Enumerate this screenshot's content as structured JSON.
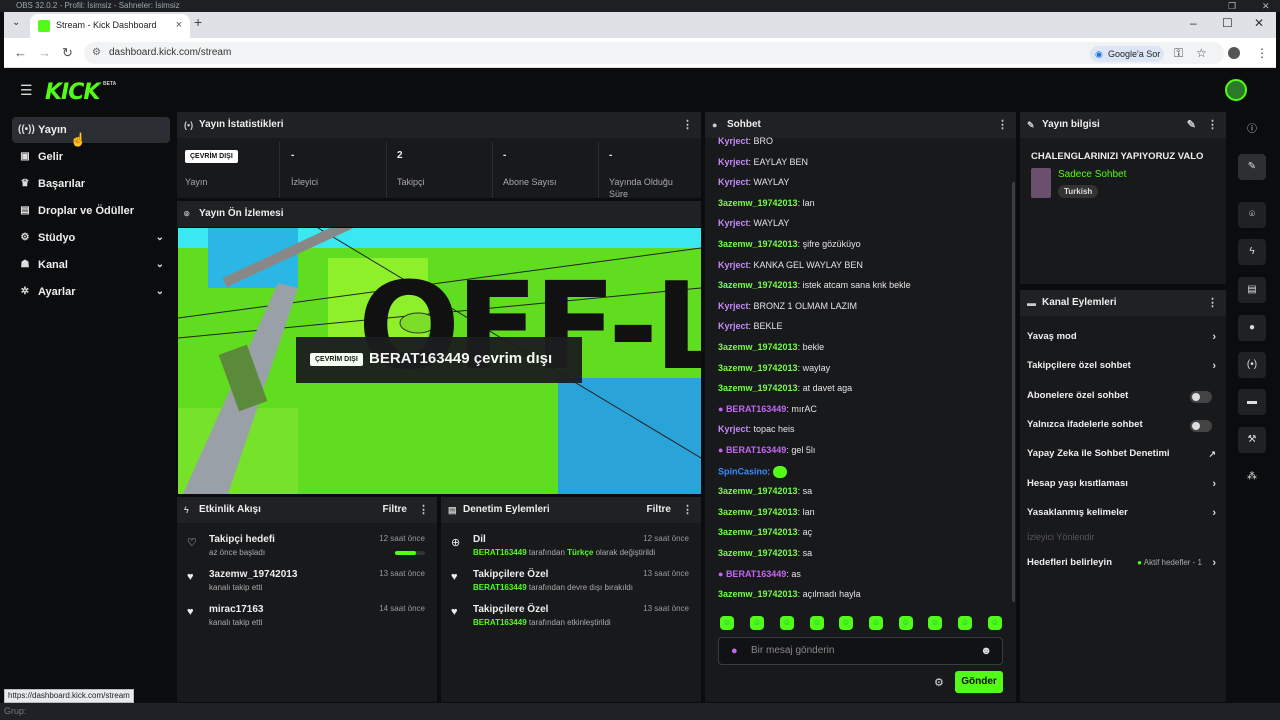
{
  "obs": {
    "title": "OBS 32.0.2 - Profil: İsimsiz - Sahneler: İsimsiz"
  },
  "browser": {
    "tab_title": "Stream - Kick Dashboard",
    "url": "dashboard.kick.com/stream",
    "google_label": "Google'a Sor",
    "status_url": "https://dashboard.kick.com/stream"
  },
  "header": {
    "logo": "KICK",
    "beta": "BETA"
  },
  "sidebar": {
    "items": [
      {
        "label": "Yayın",
        "icon": "broadcast-icon"
      },
      {
        "label": "Gelir",
        "icon": "income-icon"
      },
      {
        "label": "Başarılar",
        "icon": "trophy-icon"
      },
      {
        "label": "Droplar ve Ödüller",
        "icon": "gift-icon"
      },
      {
        "label": "Stüdyo",
        "icon": "studio-icon"
      },
      {
        "label": "Kanal",
        "icon": "channel-icon"
      },
      {
        "label": "Ayarlar",
        "icon": "gear-icon"
      }
    ]
  },
  "stats": {
    "title": "Yayın İstatistikleri",
    "status_badge": "ÇEVRİM DIŞI",
    "status_label": "Yayın",
    "items": [
      {
        "value": "-",
        "label": "İzleyici"
      },
      {
        "value": "2",
        "label": "Takipçi"
      },
      {
        "value": "-",
        "label": "Abone Sayısı"
      },
      {
        "value": "-",
        "label": "Yayında Olduğu Süre"
      }
    ]
  },
  "preview": {
    "title": "Yayın Ön İzlemesi",
    "offline_art": "OFF-LINE",
    "badge": "ÇEVRİM DIŞI",
    "text": "BERAT163449 çevrim dışı"
  },
  "events": {
    "title": "Etkinlik Akışı",
    "filter": "Filtre",
    "items": [
      {
        "title": "Takipçi hedefi",
        "sub": "az önce başladı",
        "time": "12 saat önce",
        "progress": 0.7
      },
      {
        "title": "3azemw_19742013",
        "sub": "kanalı takip etti",
        "time": "13 saat önce"
      },
      {
        "title": "mirac17163",
        "sub": "kanalı takip etti",
        "time": "14 saat önce"
      }
    ]
  },
  "moderation": {
    "title": "Denetim Eylemleri",
    "filter": "Filtre",
    "items": [
      {
        "title": "Dil",
        "user": "BERAT163449",
        "mid": " tarafından ",
        "hl": "Türkçe",
        "end": " olarak değiştirildi",
        "time": "12 saat önce"
      },
      {
        "title": "Takipçilere Özel",
        "user": "BERAT163449",
        "mid": " tarafından devre dışı bırakıldı",
        "hl": "",
        "end": "",
        "time": "13 saat önce"
      },
      {
        "title": "Takipçilere Özel",
        "user": "BERAT163449",
        "mid": " tarafından etkinleştirildi",
        "hl": "",
        "end": "",
        "time": "13 saat önce"
      }
    ]
  },
  "chat": {
    "title": "Sohbet",
    "placeholder": "Bir mesaj gönderin",
    "send": "Gönder",
    "colors": {
      "kyrject": "#c58af9",
      "azemw": "#75fd46",
      "berat": "#c466f5",
      "spin": "#3a8bff"
    },
    "messages": [
      {
        "user": "Kyrject",
        "c": "kyrject",
        "text": "BRO"
      },
      {
        "user": "Kyrject",
        "c": "kyrject",
        "text": "EAYLAY BEN"
      },
      {
        "user": "Kyrject",
        "c": "kyrject",
        "text": "WAYLAY"
      },
      {
        "user": "3azemw_19742013",
        "c": "azemw",
        "text": "lan"
      },
      {
        "user": "Kyrject",
        "c": "kyrject",
        "text": "WAYLAY"
      },
      {
        "user": "3azemw_19742013",
        "c": "azemw",
        "text": "şifre gözüküyo"
      },
      {
        "user": "Kyrject",
        "c": "kyrject",
        "text": "KANKA GEL WAYLAY BEN"
      },
      {
        "user": "3azemw_19742013",
        "c": "azemw",
        "text": "istek atcam sana knk bekle"
      },
      {
        "user": "Kyrject",
        "c": "kyrject",
        "text": "BRONZ 1 OLMAM LAZIM"
      },
      {
        "user": "Kyrject",
        "c": "kyrject",
        "text": "BEKLE"
      },
      {
        "user": "3azemw_19742013",
        "c": "azemw",
        "text": "bekle"
      },
      {
        "user": "3azemw_19742013",
        "c": "azemw",
        "text": "waylay"
      },
      {
        "user": "3azemw_19742013",
        "c": "azemw",
        "text": "at davet aga"
      },
      {
        "user": "BERAT163449",
        "c": "berat",
        "text": "mırAC",
        "mic": true
      },
      {
        "user": "Kyrject",
        "c": "kyrject",
        "text": "topac heis"
      },
      {
        "user": "BERAT163449",
        "c": "berat",
        "text": "gel 5lı",
        "mic": true
      },
      {
        "user": "SpinCasino",
        "c": "spin",
        "text": "",
        "emote": true
      },
      {
        "user": "3azemw_19742013",
        "c": "azemw",
        "text": "sa"
      },
      {
        "user": "3azemw_19742013",
        "c": "azemw",
        "text": "lan"
      },
      {
        "user": "3azemw_19742013",
        "c": "azemw",
        "text": "aç"
      },
      {
        "user": "3azemw_19742013",
        "c": "azemw",
        "text": "sa"
      },
      {
        "user": "BERAT163449",
        "c": "berat",
        "text": "as",
        "mic": true
      },
      {
        "user": "3azemw_19742013",
        "c": "azemw",
        "text": "açılmadı hayla"
      }
    ]
  },
  "stream_info": {
    "title": "Yayın bilgisi",
    "stream_title": "CHALENGLARINIZI YAPIYORUZ VALO",
    "category": "Sadece Sohbet",
    "tag": "Turkish"
  },
  "channel_actions": {
    "title": "Kanal Eylemleri",
    "items": [
      {
        "label": "Yavaş mod",
        "kind": "chevron"
      },
      {
        "label": "Takipçilere özel sohbet",
        "kind": "chevron"
      },
      {
        "label": "Abonelere özel sohbet",
        "kind": "toggle"
      },
      {
        "label": "Yalnızca ifadelerle sohbet",
        "kind": "toggle"
      },
      {
        "label": "Yapay Zeka ile Sohbet Denetimi",
        "kind": "external"
      },
      {
        "label": "Hesap yaşı kısıtlaması",
        "kind": "chevron"
      },
      {
        "label": "Yasaklanmış kelimeler",
        "kind": "chevron"
      }
    ],
    "section_label": "İzleyici Yönlendir",
    "goals_label": "Hedefleri belirleyin",
    "goals_status": "Aktif hedefler - 1"
  },
  "taskbar": {
    "label": "Grup:"
  }
}
